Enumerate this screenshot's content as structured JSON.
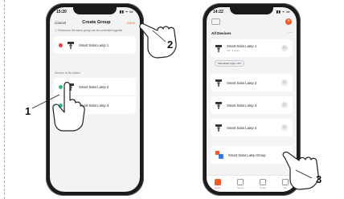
{
  "left_screen": {
    "status_time": "15:20",
    "status_icons": "▮▮ ⌁ ▭",
    "header": {
      "cancel_label": "Cancel",
      "title": "Create Group",
      "save_label": "Save"
    },
    "note": "ⓘ Devices in the same group can be controlled together",
    "group_devices": [
      "Smart Solar Lamp 1"
    ],
    "section_label": "Devices to Be Added",
    "addable_devices": [
      "Smart Solar Lamp 2",
      "Smart Solar Lamp 3"
    ]
  },
  "right_screen": {
    "status_time": "14:22",
    "section_title": "All Devices",
    "more_label": "···",
    "devices": [
      {
        "name": "Smart Solar Lamp 1",
        "sub": "Off · 4 tasks"
      },
      {
        "name": "Smart Solar Lamp 2",
        "sub": ""
      },
      {
        "name": "Smart Solar Lamp 3",
        "sub": ""
      },
      {
        "name": "Smart Solar Lamp 4",
        "sub": ""
      }
    ],
    "schedule_chip": "Scheduled Light: off ▾",
    "group_card": {
      "name": "Smart Solar Lamp Group",
      "sub": "⊘"
    },
    "tabs": [
      {
        "label": "Home",
        "active": true
      },
      {
        "label": "Scene",
        "active": false
      },
      {
        "label": "Smart",
        "active": false
      },
      {
        "label": "Me",
        "active": false
      }
    ]
  },
  "callouts": {
    "step1": "1",
    "step2": "2",
    "step3": "3"
  },
  "colors": {
    "accent": "#f05a28",
    "remove": "#e8423a",
    "add": "#2fbd7d"
  }
}
